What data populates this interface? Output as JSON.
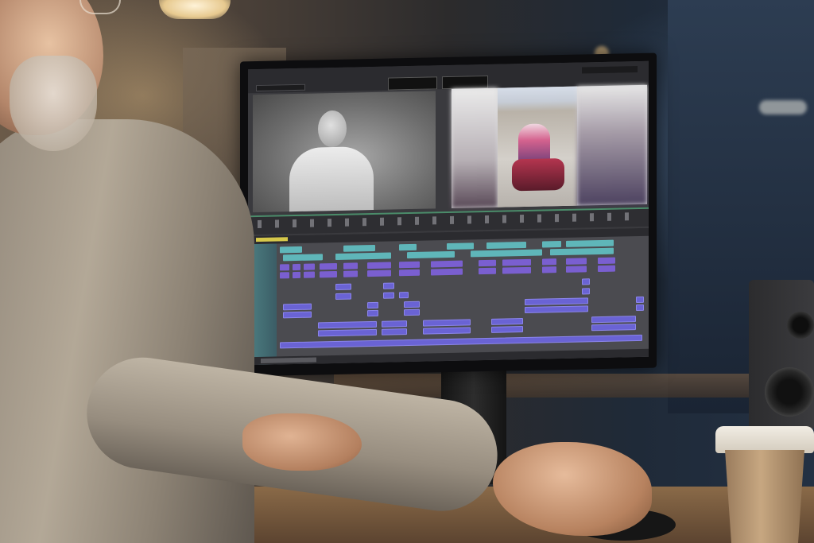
{
  "scene": {
    "description_tags": [
      "video-editing-suite",
      "monitor",
      "person",
      "coffee-cup",
      "speaker"
    ]
  },
  "editor": {
    "accent_video_clip": "#5fb6b9",
    "accent_audio_clip": "#6a63d4",
    "accent_track_header": "#4d7f82",
    "accent_ruler_marker": "#d6c84a"
  }
}
